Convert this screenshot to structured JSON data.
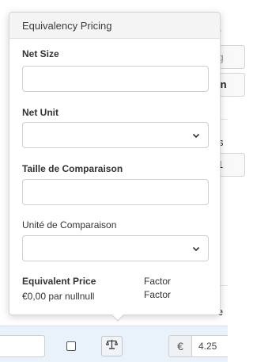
{
  "popover": {
    "title": "Equivalency Pricing",
    "fields": {
      "net_size_label": "Net Size",
      "net_size_value": "",
      "net_unit_label": "Net Unit",
      "net_unit_value": "",
      "comparison_size_label": "Taille de Comparaison",
      "comparison_size_value": "",
      "comparison_unit_label": "Unité de Comparaison",
      "comparison_unit_value": ""
    },
    "result": {
      "equivalent_price_label": "Equivalent Price",
      "equivalent_price_value": "€0,00 par nullnull",
      "factor_label": "Factor",
      "factor_value": "Factor"
    }
  },
  "background": {
    "frag_e": "e",
    "frag_g": "g",
    "frag_in": "in",
    "frag_s": "s",
    "frag_1": "1",
    "frag_le": "le"
  },
  "row": {
    "currency_symbol": "€",
    "price_value": "4.25"
  },
  "icons": {
    "chevron": "chevron-down-icon",
    "scale": "scale-icon"
  }
}
